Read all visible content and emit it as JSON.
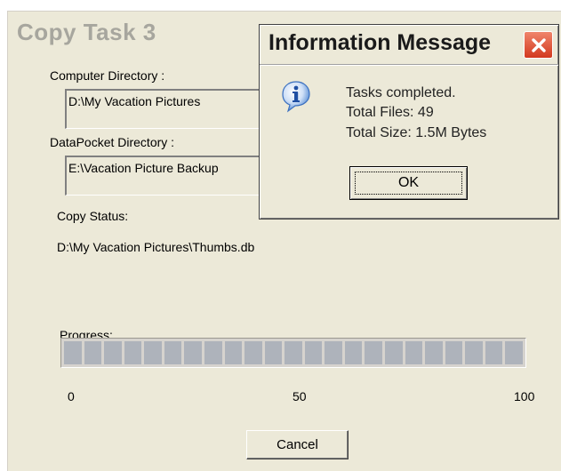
{
  "main_window": {
    "title": "Copy Task  3",
    "computer_dir_label": "Computer Directory :",
    "computer_dir_value": "D:\\My Vacation Pictures",
    "datapocket_dir_label": "DataPocket Directory :",
    "datapocket_dir_value": "E:\\Vacation Picture Backup",
    "copy_status_label": "Copy Status:",
    "copy_status_value": "D:\\My Vacation Pictures\\Thumbs.db",
    "progress_label": "Progress:",
    "progress_value": 0,
    "progress_ticks": [
      "0",
      "50",
      "100"
    ],
    "cancel_label": "Cancel"
  },
  "dialog": {
    "title": "Information Message",
    "line1": "Tasks completed.",
    "line2": "Total Files:  49",
    "line3": "Total Size:  1.5M Bytes",
    "ok_label": "OK",
    "icon": "info-icon",
    "close_icon": "close-icon"
  },
  "colors": {
    "window_bg": "#ece9d8",
    "close_button": "#d3391f",
    "progress_segment": "#aeb3bb"
  }
}
